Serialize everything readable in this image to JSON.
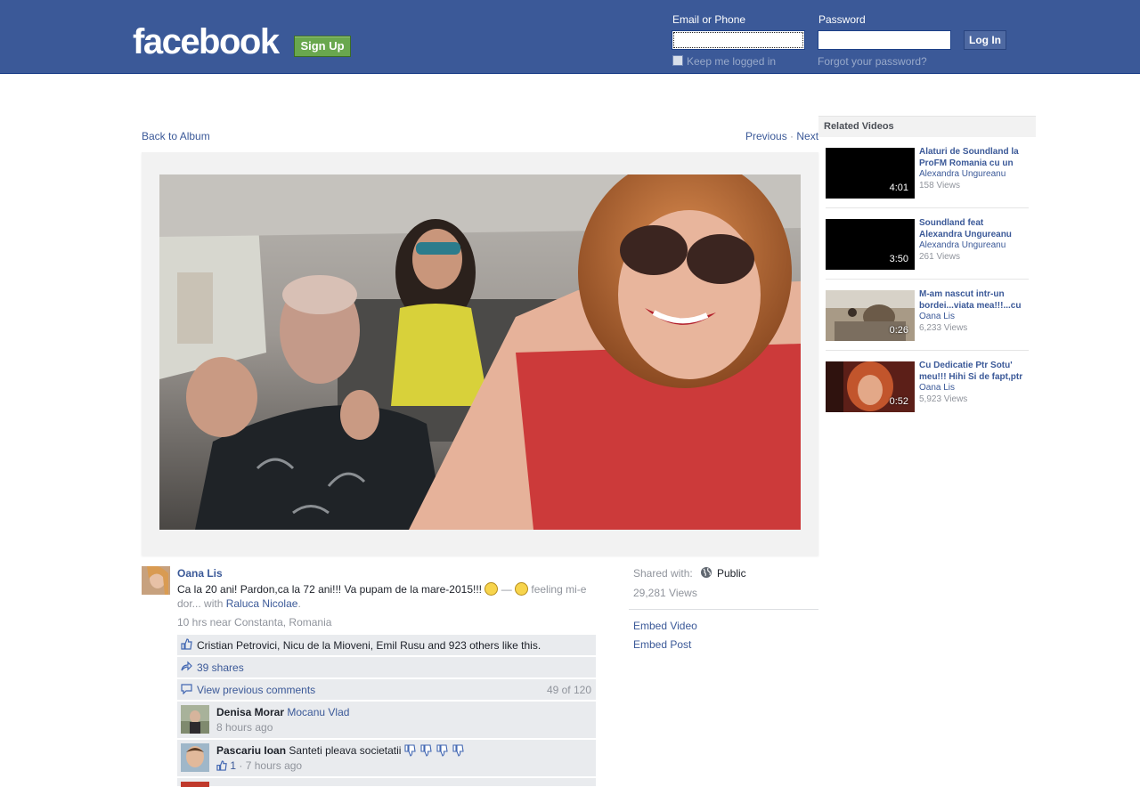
{
  "header": {
    "logo": "facebook",
    "signup_label": "Sign Up",
    "email_label": "Email or Phone",
    "password_label": "Password",
    "email_value": "",
    "password_value": "",
    "login_label": "Log In",
    "keep_logged_in": "Keep me logged in",
    "forgot": "Forgot your password?"
  },
  "nav": {
    "back": "Back to Album",
    "previous": "Previous",
    "separator": "·",
    "next": "Next"
  },
  "post": {
    "author": "Oana Lis",
    "text": "Ca la 20 ani! Pardon,ca la 72 ani!!! Va pupam de la mare-2015!!!",
    "feeling_sep": "—",
    "feeling": "feeling mi-e dor...",
    "with_label": "with",
    "tagged": "Raluca Nicolae",
    "period": ".",
    "meta": "10 hrs near Constanta, Romania",
    "likes": "Cristian Petrovici, Nicu de la Mioveni, Emil Rusu and 923 others like this.",
    "shares": "39 shares",
    "view_previous": "View previous comments",
    "comment_count": "49 of 120",
    "comments": [
      {
        "name": "Denisa Morar",
        "text": "Mocanu Vlad",
        "time": "8 hours ago"
      },
      {
        "name": "Pascariu Ioan",
        "text": "Santeti pleava societatii",
        "likes": "1",
        "time": "7 hours ago"
      }
    ]
  },
  "sidebar_info": {
    "shared_with": "Shared with:",
    "audience": "Public",
    "views": "29,281 Views",
    "embed_video": "Embed Video",
    "embed_post": "Embed Post"
  },
  "related": {
    "heading": "Related Videos",
    "items": [
      {
        "title": "Alaturi de Soundland la ProFM Romania cu un",
        "author": "Alexandra Ungureanu",
        "views": "158 Views",
        "duration": "4:01"
      },
      {
        "title": "Soundland feat Alexandra Ungureanu",
        "author": "Alexandra Ungureanu",
        "views": "261 Views",
        "duration": "3:50"
      },
      {
        "title": "M-am nascut intr-un bordei...viata mea!!!...cu",
        "author": "Oana Lis",
        "views": "6,233 Views",
        "duration": "0:26"
      },
      {
        "title": "Cu Dedicatie Ptr Sotu' meu!!! Hihi Si de fapt,ptr",
        "author": "Oana Lis",
        "views": "5,923 Views",
        "duration": "0:52"
      }
    ]
  }
}
